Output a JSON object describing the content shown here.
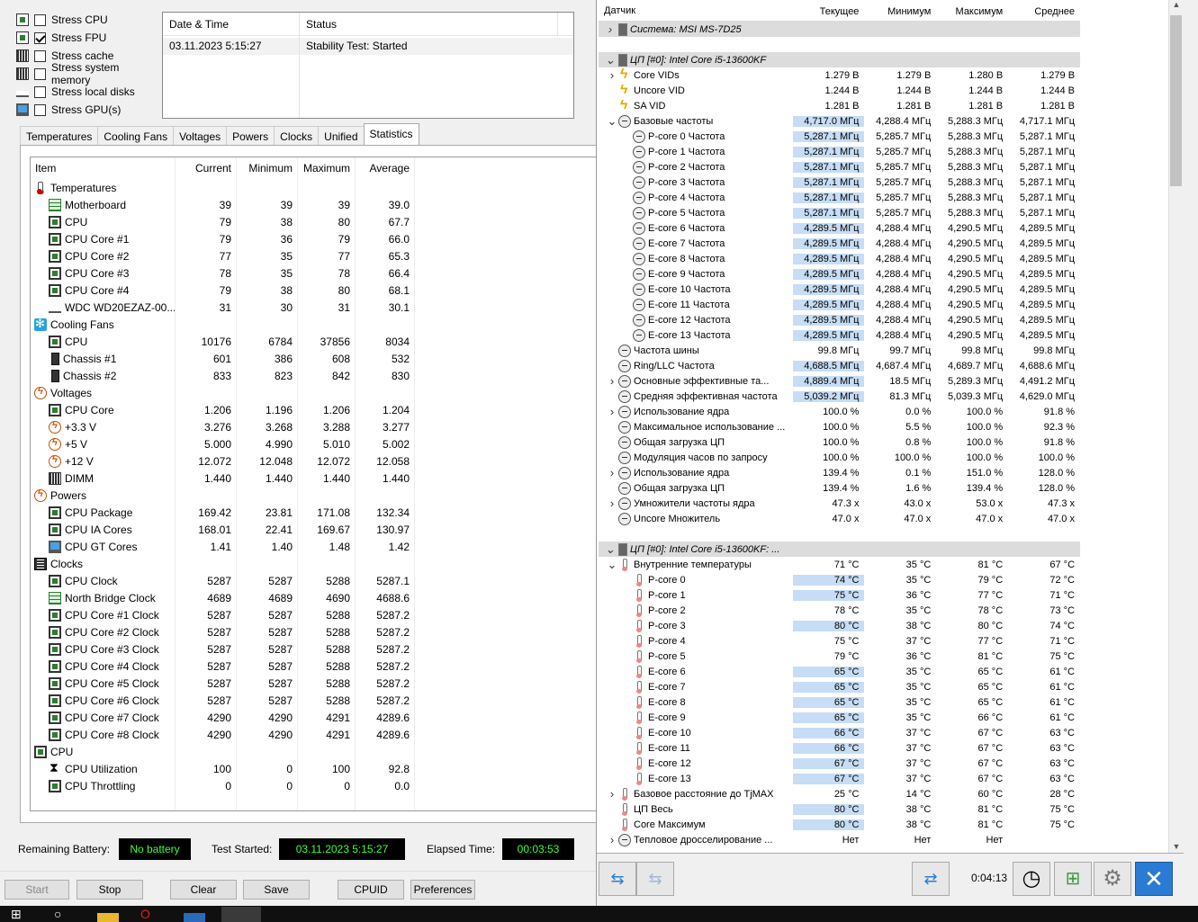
{
  "stress_options": [
    {
      "label": "Stress CPU",
      "checked": false,
      "icon": "cpu-chip-icon"
    },
    {
      "label": "Stress FPU",
      "checked": true,
      "icon": "fpu-percent-icon"
    },
    {
      "label": "Stress cache",
      "checked": false,
      "icon": "cache-chip-icon"
    },
    {
      "label": "Stress system memory",
      "checked": false,
      "icon": "memory-module-icon"
    },
    {
      "label": "Stress local disks",
      "checked": false,
      "icon": "hard-disk-icon"
    },
    {
      "label": "Stress GPU(s)",
      "checked": false,
      "icon": "monitor-icon"
    }
  ],
  "status_table": {
    "headers": [
      "Date & Time",
      "Status"
    ],
    "rows": [
      [
        "03.11.2023 5:15:27",
        "Stability Test: Started"
      ]
    ]
  },
  "tabs": [
    "Temperatures",
    "Cooling Fans",
    "Voltages",
    "Powers",
    "Clocks",
    "Unified",
    "Statistics"
  ],
  "active_tab": "Statistics",
  "stats": {
    "headers": [
      "Item",
      "Current",
      "Minimum",
      "Maximum",
      "Average"
    ],
    "rows": [
      {
        "type": "group",
        "label": "Temperatures",
        "icon": "thermometer-icon"
      },
      {
        "label": "Motherboard",
        "icon": "motherboard-icon",
        "v": [
          "39",
          "39",
          "39",
          "39.0"
        ]
      },
      {
        "label": "CPU",
        "icon": "chip-icon",
        "v": [
          "79",
          "38",
          "80",
          "67.7"
        ]
      },
      {
        "label": "CPU Core #1",
        "icon": "chip-icon",
        "v": [
          "79",
          "36",
          "79",
          "66.0"
        ]
      },
      {
        "label": "CPU Core #2",
        "icon": "chip-icon",
        "v": [
          "77",
          "35",
          "77",
          "65.3"
        ]
      },
      {
        "label": "CPU Core #3",
        "icon": "chip-icon",
        "v": [
          "78",
          "35",
          "78",
          "66.4"
        ]
      },
      {
        "label": "CPU Core #4",
        "icon": "chip-icon",
        "v": [
          "79",
          "38",
          "80",
          "68.1"
        ]
      },
      {
        "label": "WDC WD20EZAZ-00...",
        "icon": "hard-disk-icon",
        "v": [
          "31",
          "30",
          "31",
          "30.1"
        ]
      },
      {
        "type": "group",
        "label": "Cooling Fans",
        "icon": "fan-icon"
      },
      {
        "label": "CPU",
        "icon": "chip-icon",
        "v": [
          "10176",
          "6784",
          "37856",
          "8034"
        ]
      },
      {
        "label": "Chassis #1",
        "icon": "case-icon",
        "v": [
          "601",
          "386",
          "608",
          "532"
        ]
      },
      {
        "label": "Chassis #2",
        "icon": "case-icon",
        "v": [
          "833",
          "823",
          "842",
          "830"
        ]
      },
      {
        "type": "group",
        "label": "Voltages",
        "icon": "voltage-icon"
      },
      {
        "label": "CPU Core",
        "icon": "chip-icon",
        "v": [
          "1.206",
          "1.196",
          "1.206",
          "1.204"
        ]
      },
      {
        "label": "+3.3 V",
        "icon": "voltage-icon",
        "v": [
          "3.276",
          "3.268",
          "3.288",
          "3.277"
        ]
      },
      {
        "label": "+5 V",
        "icon": "voltage-icon",
        "v": [
          "5.000",
          "4.990",
          "5.010",
          "5.002"
        ]
      },
      {
        "label": "+12 V",
        "icon": "voltage-icon",
        "v": [
          "12.072",
          "12.048",
          "12.072",
          "12.058"
        ]
      },
      {
        "label": "DIMM",
        "icon": "memory-module-icon",
        "v": [
          "1.440",
          "1.440",
          "1.440",
          "1.440"
        ]
      },
      {
        "type": "group",
        "label": "Powers",
        "icon": "voltage-icon"
      },
      {
        "label": "CPU Package",
        "icon": "chip-icon",
        "v": [
          "169.42",
          "23.81",
          "171.08",
          "132.34"
        ]
      },
      {
        "label": "CPU IA Cores",
        "icon": "chip-icon",
        "v": [
          "168.01",
          "22.41",
          "169.67",
          "130.97"
        ]
      },
      {
        "label": "CPU GT Cores",
        "icon": "monitor-icon",
        "v": [
          "1.41",
          "1.40",
          "1.48",
          "1.42"
        ]
      },
      {
        "type": "group",
        "label": "Clocks",
        "icon": "clock-chip-icon"
      },
      {
        "label": "CPU Clock",
        "icon": "chip-icon",
        "v": [
          "5287",
          "5287",
          "5288",
          "5287.1"
        ]
      },
      {
        "label": "North Bridge Clock",
        "icon": "motherboard-icon",
        "v": [
          "4689",
          "4689",
          "4690",
          "4688.6"
        ]
      },
      {
        "label": "CPU Core #1 Clock",
        "icon": "chip-icon",
        "v": [
          "5287",
          "5287",
          "5288",
          "5287.2"
        ]
      },
      {
        "label": "CPU Core #2 Clock",
        "icon": "chip-icon",
        "v": [
          "5287",
          "5287",
          "5288",
          "5287.2"
        ]
      },
      {
        "label": "CPU Core #3 Clock",
        "icon": "chip-icon",
        "v": [
          "5287",
          "5287",
          "5288",
          "5287.2"
        ]
      },
      {
        "label": "CPU Core #4 Clock",
        "icon": "chip-icon",
        "v": [
          "5287",
          "5287",
          "5288",
          "5287.2"
        ]
      },
      {
        "label": "CPU Core #5 Clock",
        "icon": "chip-icon",
        "v": [
          "5287",
          "5287",
          "5288",
          "5287.2"
        ]
      },
      {
        "label": "CPU Core #6 Clock",
        "icon": "chip-icon",
        "v": [
          "5287",
          "5287",
          "5288",
          "5287.2"
        ]
      },
      {
        "label": "CPU Core #7 Clock",
        "icon": "chip-icon",
        "v": [
          "4290",
          "4290",
          "4291",
          "4289.6"
        ]
      },
      {
        "label": "CPU Core #8 Clock",
        "icon": "chip-icon",
        "v": [
          "4290",
          "4290",
          "4291",
          "4289.6"
        ]
      },
      {
        "type": "group",
        "label": "CPU",
        "icon": "chip-icon"
      },
      {
        "label": "CPU Utilization",
        "icon": "hourglass-icon",
        "v": [
          "100",
          "0",
          "100",
          "92.8"
        ]
      },
      {
        "label": "CPU Throttling",
        "icon": "chip-icon",
        "v": [
          "0",
          "0",
          "0",
          "0.0"
        ]
      }
    ]
  },
  "footer": {
    "remaining_battery_label": "Remaining Battery:",
    "remaining_battery_value": "No battery",
    "test_started_label": "Test Started:",
    "test_started_value": "03.11.2023 5:15:27",
    "elapsed_label": "Elapsed Time:",
    "elapsed_value": "00:03:53"
  },
  "buttons": {
    "start": "Start",
    "stop": "Stop",
    "clear": "Clear",
    "save": "Save",
    "cpuid": "CPUID",
    "preferences": "Preferences"
  },
  "hw": {
    "headers": [
      "Датчик",
      "Текущее",
      "Минимум",
      "Максимум",
      "Среднее"
    ],
    "rows": [
      {
        "type": "group",
        "exp": ">",
        "label": "Система: MSI MS-7D25",
        "icon": "cpu-icon",
        "indent": 0
      },
      {
        "type": "blank"
      },
      {
        "type": "group",
        "exp": "v",
        "label": "ЦП [#0]: Intel Core i5-13600KF",
        "icon": "cpu-icon",
        "indent": 0
      },
      {
        "exp": ">",
        "label": "Core VIDs",
        "icon": "bolt-icon",
        "indent": 1,
        "v": [
          "1.279 В",
          "1.279 В",
          "1.280 В",
          "1.279 В"
        ]
      },
      {
        "label": "Uncore VID",
        "icon": "bolt-icon",
        "indent": 0,
        "v": [
          "1.244 В",
          "1.244 В",
          "1.244 В",
          "1.244 В"
        ]
      },
      {
        "label": "SA VID",
        "icon": "bolt-icon",
        "indent": 0,
        "v": [
          "1.281 В",
          "1.281 В",
          "1.281 В",
          "1.281 В"
        ]
      },
      {
        "exp": "v",
        "label": "Базовые частоты",
        "icon": "gauge-icon",
        "indent": 1,
        "hl": true,
        "v": [
          "4,717.0 МГц",
          "4,288.4 МГц",
          "5,288.3 МГц",
          "4,717.1 МГц"
        ]
      },
      {
        "label": "P-core 0 Частота",
        "icon": "gauge-icon",
        "indent": 2,
        "hl": true,
        "v": [
          "5,287.1 МГц",
          "5,285.7 МГц",
          "5,288.3 МГц",
          "5,287.1 МГц"
        ]
      },
      {
        "label": "P-core 1 Частота",
        "icon": "gauge-icon",
        "indent": 2,
        "hl": true,
        "v": [
          "5,287.1 МГц",
          "5,285.7 МГц",
          "5,288.3 МГц",
          "5,287.1 МГц"
        ]
      },
      {
        "label": "P-core 2 Частота",
        "icon": "gauge-icon",
        "indent": 2,
        "hl": true,
        "v": [
          "5,287.1 МГц",
          "5,285.7 МГц",
          "5,288.3 МГц",
          "5,287.1 МГц"
        ]
      },
      {
        "label": "P-core 3 Частота",
        "icon": "gauge-icon",
        "indent": 2,
        "hl": true,
        "v": [
          "5,287.1 МГц",
          "5,285.7 МГц",
          "5,288.3 МГц",
          "5,287.1 МГц"
        ]
      },
      {
        "label": "P-core 4 Частота",
        "icon": "gauge-icon",
        "indent": 2,
        "hl": true,
        "v": [
          "5,287.1 МГц",
          "5,285.7 МГц",
          "5,288.3 МГц",
          "5,287.1 МГц"
        ]
      },
      {
        "label": "P-core 5 Частота",
        "icon": "gauge-icon",
        "indent": 2,
        "hl": true,
        "v": [
          "5,287.1 МГц",
          "5,285.7 МГц",
          "5,288.3 МГц",
          "5,287.1 МГц"
        ]
      },
      {
        "label": "E-core 6 Частота",
        "icon": "gauge-icon",
        "indent": 2,
        "hl": true,
        "v": [
          "4,289.5 МГц",
          "4,288.4 МГц",
          "4,290.5 МГц",
          "4,289.5 МГц"
        ]
      },
      {
        "label": "E-core 7 Частота",
        "icon": "gauge-icon",
        "indent": 2,
        "hl": true,
        "v": [
          "4,289.5 МГц",
          "4,288.4 МГц",
          "4,290.5 МГц",
          "4,289.5 МГц"
        ]
      },
      {
        "label": "E-core 8 Частота",
        "icon": "gauge-icon",
        "indent": 2,
        "hl": true,
        "v": [
          "4,289.5 МГц",
          "4,288.4 МГц",
          "4,290.5 МГц",
          "4,289.5 МГц"
        ]
      },
      {
        "label": "E-core 9 Частота",
        "icon": "gauge-icon",
        "indent": 2,
        "hl": true,
        "v": [
          "4,289.5 МГц",
          "4,288.4 МГц",
          "4,290.5 МГц",
          "4,289.5 МГц"
        ]
      },
      {
        "label": "E-core 10 Частота",
        "icon": "gauge-icon",
        "indent": 2,
        "hl": true,
        "v": [
          "4,289.5 МГц",
          "4,288.4 МГц",
          "4,290.5 МГц",
          "4,289.5 МГц"
        ]
      },
      {
        "label": "E-core 11 Частота",
        "icon": "gauge-icon",
        "indent": 2,
        "hl": true,
        "v": [
          "4,289.5 МГц",
          "4,288.4 МГц",
          "4,290.5 МГц",
          "4,289.5 МГц"
        ]
      },
      {
        "label": "E-core 12 Частота",
        "icon": "gauge-icon",
        "indent": 2,
        "hl": true,
        "v": [
          "4,289.5 МГц",
          "4,288.4 МГц",
          "4,290.5 МГц",
          "4,289.5 МГц"
        ]
      },
      {
        "label": "E-core 13 Частота",
        "icon": "gauge-icon",
        "indent": 2,
        "hl": true,
        "v": [
          "4,289.5 МГц",
          "4,288.4 МГц",
          "4,290.5 МГц",
          "4,289.5 МГц"
        ]
      },
      {
        "label": "Частота шины",
        "icon": "gauge-icon",
        "indent": 0,
        "v": [
          "99.8 МГц",
          "99.7 МГц",
          "99.8 МГц",
          "99.8 МГц"
        ]
      },
      {
        "label": "Ring/LLC Частота",
        "icon": "gauge-icon",
        "indent": 0,
        "hl": true,
        "v": [
          "4,688.5 МГц",
          "4,687.4 МГц",
          "4,689.7 МГц",
          "4,688.6 МГц"
        ]
      },
      {
        "exp": ">",
        "label": "Основные эффективные та...",
        "icon": "gauge-icon",
        "indent": 1,
        "hl": true,
        "v": [
          "4,889.4 МГц",
          "18.5 МГц",
          "5,289.3 МГц",
          "4,491.2 МГц"
        ]
      },
      {
        "label": "Средняя эффективная частота",
        "icon": "gauge-icon",
        "indent": 0,
        "hl": true,
        "v": [
          "5,039.2 МГц",
          "81.3 МГц",
          "5,039.3 МГц",
          "4,629.0 МГц"
        ]
      },
      {
        "exp": ">",
        "label": "Использование ядра",
        "icon": "gauge-icon",
        "indent": 1,
        "v": [
          "100.0 %",
          "0.0 %",
          "100.0 %",
          "91.8 %"
        ]
      },
      {
        "label": "Максимальное использование ...",
        "icon": "gauge-icon",
        "indent": 0,
        "v": [
          "100.0 %",
          "5.5 %",
          "100.0 %",
          "92.3 %"
        ]
      },
      {
        "label": "Общая загрузка ЦП",
        "icon": "gauge-icon",
        "indent": 0,
        "v": [
          "100.0 %",
          "0.8 %",
          "100.0 %",
          "91.8 %"
        ]
      },
      {
        "label": "Модуляция часов по запросу",
        "icon": "gauge-icon",
        "indent": 0,
        "v": [
          "100.0 %",
          "100.0 %",
          "100.0 %",
          "100.0 %"
        ]
      },
      {
        "exp": ">",
        "label": "Использование ядра",
        "icon": "gauge-icon",
        "indent": 1,
        "v": [
          "139.4 %",
          "0.1 %",
          "151.0 %",
          "128.0 %"
        ]
      },
      {
        "label": "Общая загрузка ЦП",
        "icon": "gauge-icon",
        "indent": 0,
        "v": [
          "139.4 %",
          "1.6 %",
          "139.4 %",
          "128.0 %"
        ]
      },
      {
        "exp": ">",
        "label": "Умножители частоты ядра",
        "icon": "gauge-icon",
        "indent": 1,
        "v": [
          "47.3 x",
          "43.0 x",
          "53.0 x",
          "47.3 x"
        ]
      },
      {
        "label": "Uncore Множитель",
        "icon": "gauge-icon",
        "indent": 0,
        "v": [
          "47.0 x",
          "47.0 x",
          "47.0 x",
          "47.0 x"
        ]
      },
      {
        "type": "blank"
      },
      {
        "type": "group",
        "exp": "v",
        "label": "ЦП [#0]: Intel Core i5-13600KF: ...",
        "icon": "cpu-icon",
        "indent": 0
      },
      {
        "exp": "v",
        "label": "Внутренние температуры",
        "icon": "thermo-icon",
        "indent": 1,
        "v": [
          "71 °C",
          "35 °C",
          "81 °C",
          "67 °C"
        ]
      },
      {
        "label": "P-core 0",
        "icon": "thermo-icon",
        "indent": 2,
        "hl": true,
        "v": [
          "74 °C",
          "35 °C",
          "79 °C",
          "72 °C"
        ]
      },
      {
        "label": "P-core 1",
        "icon": "thermo-icon",
        "indent": 2,
        "hl": true,
        "v": [
          "75 °C",
          "36 °C",
          "77 °C",
          "71 °C"
        ]
      },
      {
        "label": "P-core 2",
        "icon": "thermo-icon",
        "indent": 2,
        "v": [
          "78 °C",
          "35 °C",
          "78 °C",
          "73 °C"
        ]
      },
      {
        "label": "P-core 3",
        "icon": "thermo-icon",
        "indent": 2,
        "hl": true,
        "v": [
          "80 °C",
          "38 °C",
          "80 °C",
          "74 °C"
        ]
      },
      {
        "label": "P-core 4",
        "icon": "thermo-icon",
        "indent": 2,
        "v": [
          "75 °C",
          "37 °C",
          "77 °C",
          "71 °C"
        ]
      },
      {
        "label": "P-core 5",
        "icon": "thermo-icon",
        "indent": 2,
        "v": [
          "79 °C",
          "36 °C",
          "81 °C",
          "75 °C"
        ]
      },
      {
        "label": "E-core 6",
        "icon": "thermo-icon",
        "indent": 2,
        "hl": true,
        "v": [
          "65 °C",
          "35 °C",
          "65 °C",
          "61 °C"
        ]
      },
      {
        "label": "E-core 7",
        "icon": "thermo-icon",
        "indent": 2,
        "hl": true,
        "v": [
          "65 °C",
          "35 °C",
          "65 °C",
          "61 °C"
        ]
      },
      {
        "label": "E-core 8",
        "icon": "thermo-icon",
        "indent": 2,
        "hl": true,
        "v": [
          "65 °C",
          "35 °C",
          "65 °C",
          "61 °C"
        ]
      },
      {
        "label": "E-core 9",
        "icon": "thermo-icon",
        "indent": 2,
        "hl": true,
        "v": [
          "65 °C",
          "35 °C",
          "66 °C",
          "61 °C"
        ]
      },
      {
        "label": "E-core 10",
        "icon": "thermo-icon",
        "indent": 2,
        "hl": true,
        "v": [
          "66 °C",
          "37 °C",
          "67 °C",
          "63 °C"
        ]
      },
      {
        "label": "E-core 11",
        "icon": "thermo-icon",
        "indent": 2,
        "hl": true,
        "v": [
          "66 °C",
          "37 °C",
          "67 °C",
          "63 °C"
        ]
      },
      {
        "label": "E-core 12",
        "icon": "thermo-icon",
        "indent": 2,
        "hl": true,
        "v": [
          "67 °C",
          "37 °C",
          "67 °C",
          "63 °C"
        ]
      },
      {
        "label": "E-core 13",
        "icon": "thermo-icon",
        "indent": 2,
        "hl": true,
        "v": [
          "67 °C",
          "37 °C",
          "67 °C",
          "63 °C"
        ]
      },
      {
        "exp": ">",
        "label": "Базовое расстояние до TjMAX",
        "icon": "thermo-icon",
        "indent": 1,
        "v": [
          "25 °C",
          "14 °C",
          "60 °C",
          "28 °C"
        ]
      },
      {
        "label": "ЦП Весь",
        "icon": "thermo-icon",
        "indent": 0,
        "hl": true,
        "v": [
          "80 °C",
          "38 °C",
          "81 °C",
          "75 °C"
        ]
      },
      {
        "label": "Core Максимум",
        "icon": "thermo-icon",
        "indent": 0,
        "hl": true,
        "v": [
          "80 °C",
          "38 °C",
          "81 °C",
          "75 °C"
        ]
      },
      {
        "exp": ">",
        "label": "Тепловое дросселирование ...",
        "icon": "gauge-icon",
        "indent": 1,
        "v": [
          "Нет",
          "Нет",
          "Нет",
          ""
        ]
      }
    ]
  },
  "hw_footer": {
    "timer": "0:04:13"
  },
  "colors": {
    "highlight": "#c6ddf5",
    "lcd_text": "#3cff3c",
    "group_bg": "#dcdcdc"
  }
}
